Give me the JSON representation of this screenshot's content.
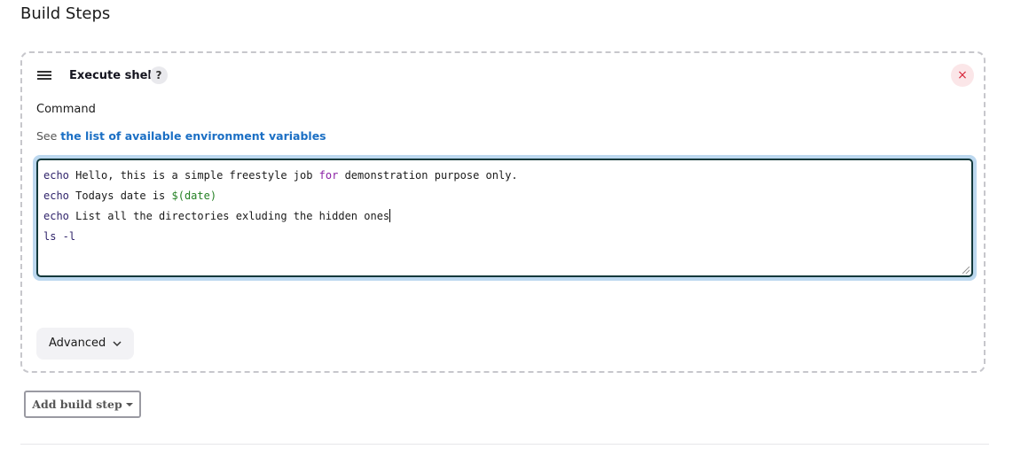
{
  "section": {
    "title": "Build Steps"
  },
  "step": {
    "title": "Execute shell",
    "help_label": "?",
    "close_label": "×",
    "command_label": "Command",
    "env_hint_prefix": "See ",
    "env_hint_link": "the list of available environment variables",
    "code": {
      "line1_cmd": "echo",
      "line1_a": " Hello, this is a simple freestyle job ",
      "line1_kw": "for",
      "line1_b": " demonstration purpose only.",
      "line2_cmd": "echo",
      "line2_a": " Todays date is ",
      "line2_var": "$(date)",
      "line3_cmd": "echo",
      "line3_a": " List all the directories exluding the hidden ones",
      "line4": "ls -l"
    },
    "advanced_label": "Advanced"
  },
  "add_build_step": {
    "label": "Add build step"
  },
  "colors": {
    "link": "#1b6fc4",
    "close": "#d8283b",
    "editor_border": "#12393b",
    "focus_ring": "#bcd8ef"
  },
  "icons": {
    "drag": "drag-handle-icon",
    "help": "help-icon",
    "close": "close-icon",
    "chevron": "chevron-down-icon",
    "caret": "caret-down-icon"
  }
}
